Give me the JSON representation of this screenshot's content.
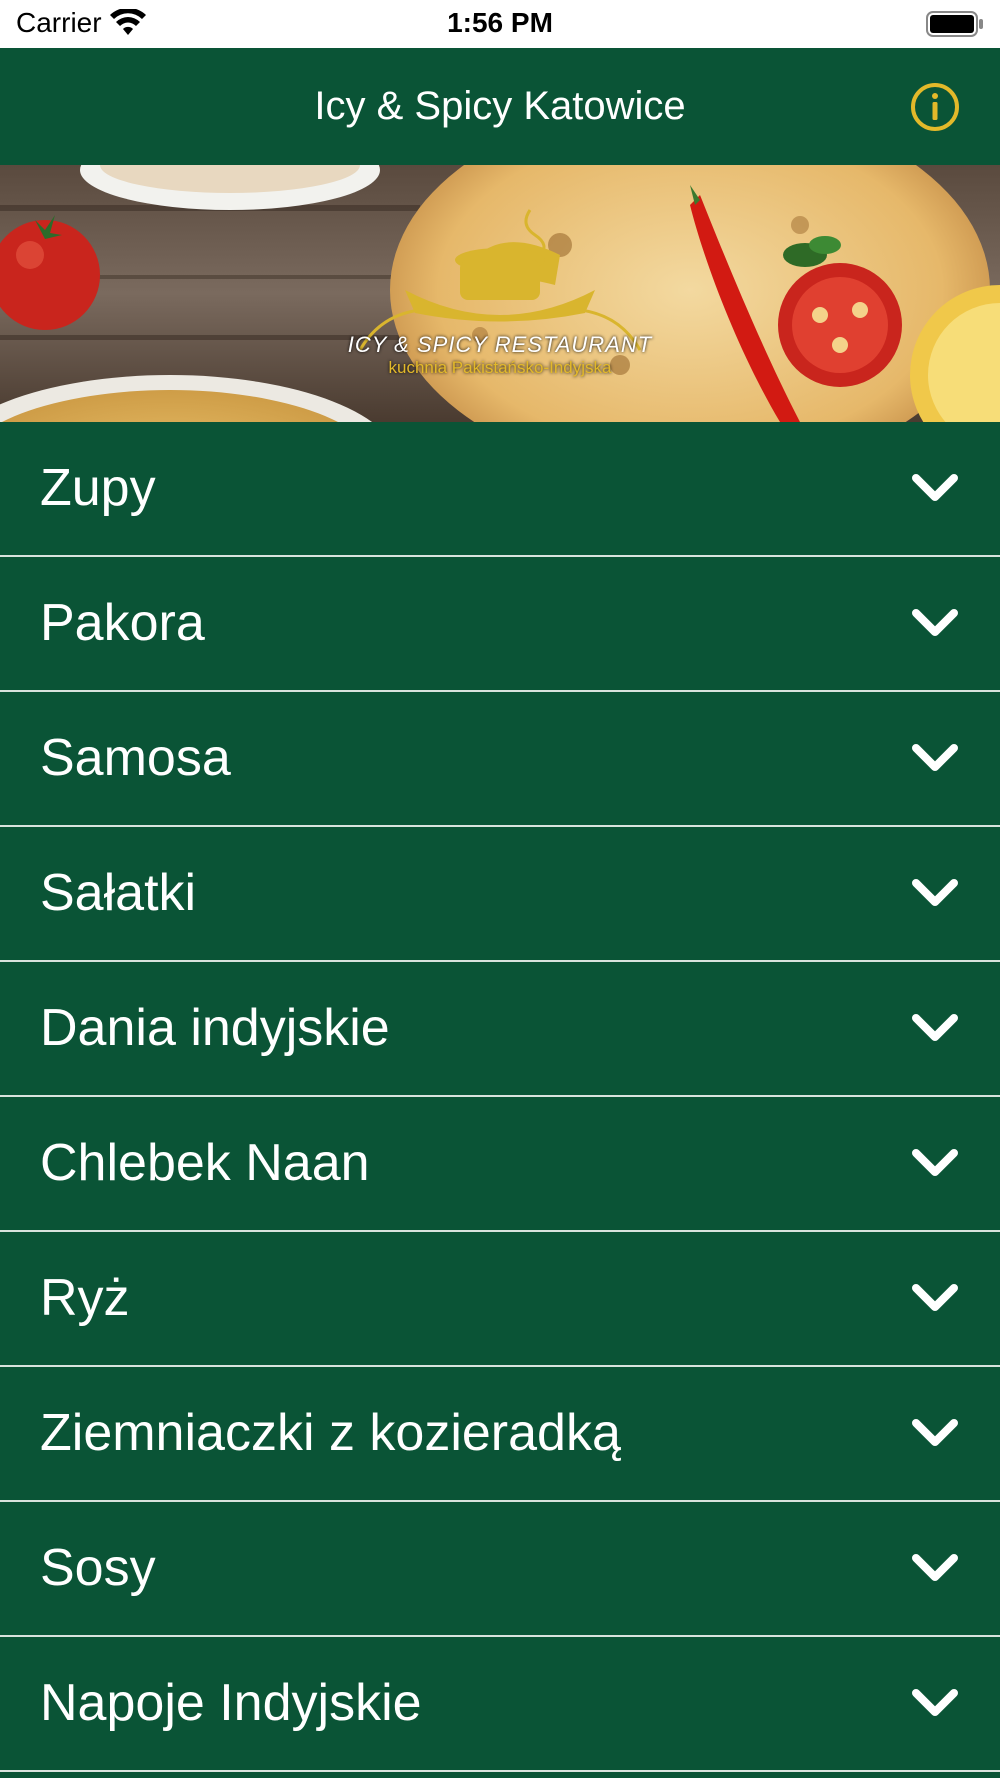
{
  "status_bar": {
    "carrier": "Carrier",
    "time": "1:56 PM"
  },
  "nav": {
    "title": "Icy & Spicy Katowice",
    "info_icon": "info-circle-icon"
  },
  "banner": {
    "logo_line1": "ICY & SPICY RESTAURANT",
    "logo_line2": "kuchnia Pakistańsko-Indyjska"
  },
  "menu": {
    "items": [
      {
        "label": "Zupy"
      },
      {
        "label": "Pakora"
      },
      {
        "label": "Samosa"
      },
      {
        "label": "Sałatki"
      },
      {
        "label": "Dania indyjskie"
      },
      {
        "label": "Chlebek Naan"
      },
      {
        "label": "Ryż"
      },
      {
        "label": "Ziemniaczki z kozieradką"
      },
      {
        "label": "Sosy"
      },
      {
        "label": "Napoje Indyjskie"
      }
    ],
    "chevron_icon": "chevron-down-icon"
  },
  "colors": {
    "primary_green": "#0a5436",
    "accent_gold": "#e3b92a",
    "text_white": "#ffffff"
  }
}
